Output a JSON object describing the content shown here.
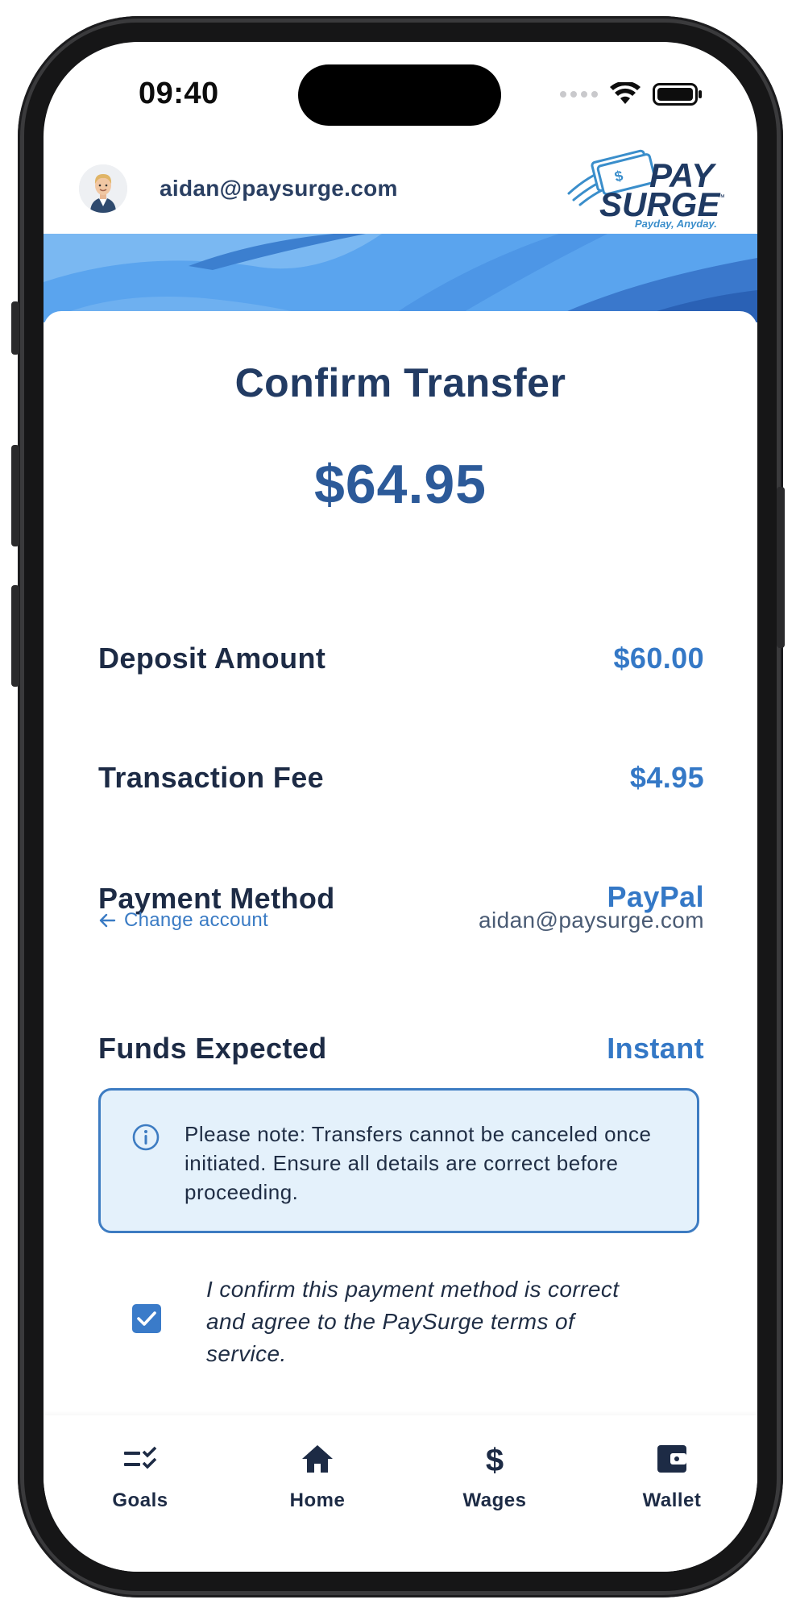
{
  "status_bar": {
    "time": "09:40"
  },
  "header": {
    "email": "aidan@paysurge.com",
    "logo": {
      "line1": "PAY",
      "line2": "SURGE",
      "tm": "™",
      "tagline": "Payday, Anyday."
    }
  },
  "transfer": {
    "title": "Confirm Transfer",
    "total": "$64.95",
    "rows": {
      "deposit": {
        "label": "Deposit Amount",
        "value": "$60.00"
      },
      "fee": {
        "label": "Transaction Fee",
        "value": "$4.95"
      },
      "payment": {
        "label": "Payment Method",
        "value": "PayPal",
        "account": "aidan@paysurge.com",
        "change_label": "Change account"
      },
      "funds": {
        "label": "Funds Expected",
        "value": "Instant"
      }
    },
    "notice": "Please note: Transfers cannot be canceled once initiated. Ensure all details are correct before proceeding.",
    "confirm": {
      "checked": true,
      "text": "I confirm this payment method is correct and agree to the PaySurge terms of service."
    }
  },
  "nav": {
    "items": [
      {
        "label": "Goals",
        "icon": "goals-checklist-icon"
      },
      {
        "label": "Home",
        "icon": "home-icon"
      },
      {
        "label": "Wages",
        "icon": "dollar-icon"
      },
      {
        "label": "Wallet",
        "icon": "wallet-icon"
      }
    ],
    "active": "Wallet"
  },
  "colors": {
    "primary": "#223b63",
    "accent": "#3478c6",
    "notice_bg": "#e4f1fb",
    "notice_border": "#3d7cc2"
  }
}
